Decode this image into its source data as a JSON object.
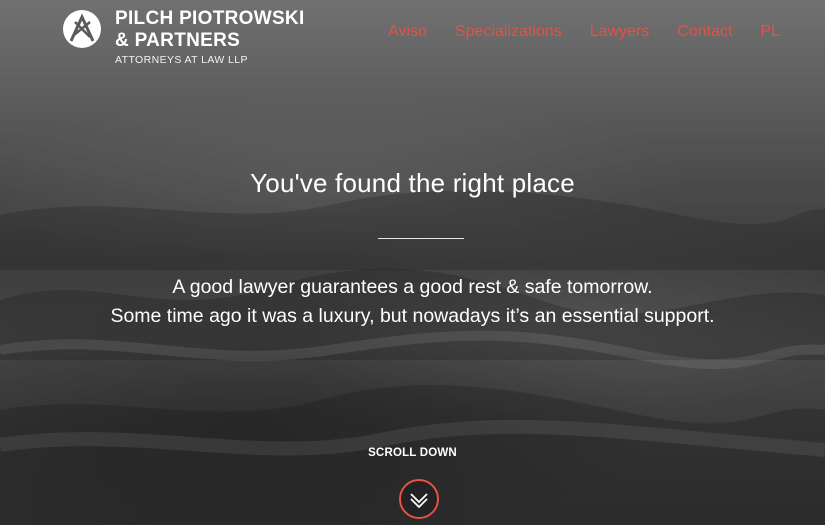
{
  "brand": {
    "line1": "PILCH PIOTROWSKI",
    "line2": "& PARTNERS",
    "subtitle": "ATTORNEYS AT LAW LLP"
  },
  "nav": {
    "items": [
      {
        "label": "Aviso"
      },
      {
        "label": "Specializations"
      },
      {
        "label": "Lawyers"
      },
      {
        "label": "Contact"
      },
      {
        "label": "PL"
      }
    ]
  },
  "hero": {
    "headline": "You've found the right place",
    "tagline_line1": "A good lawyer guarantees a good rest & safe tomorrow.",
    "tagline_line2": "Some time ago it was a luxury, but nowadays it’s an essential support.",
    "scroll_label": "SCROLL DOWN",
    "scroll_icon": "chevron-down-icon"
  },
  "colors": {
    "accent": "#e35245",
    "text": "#ffffff"
  }
}
